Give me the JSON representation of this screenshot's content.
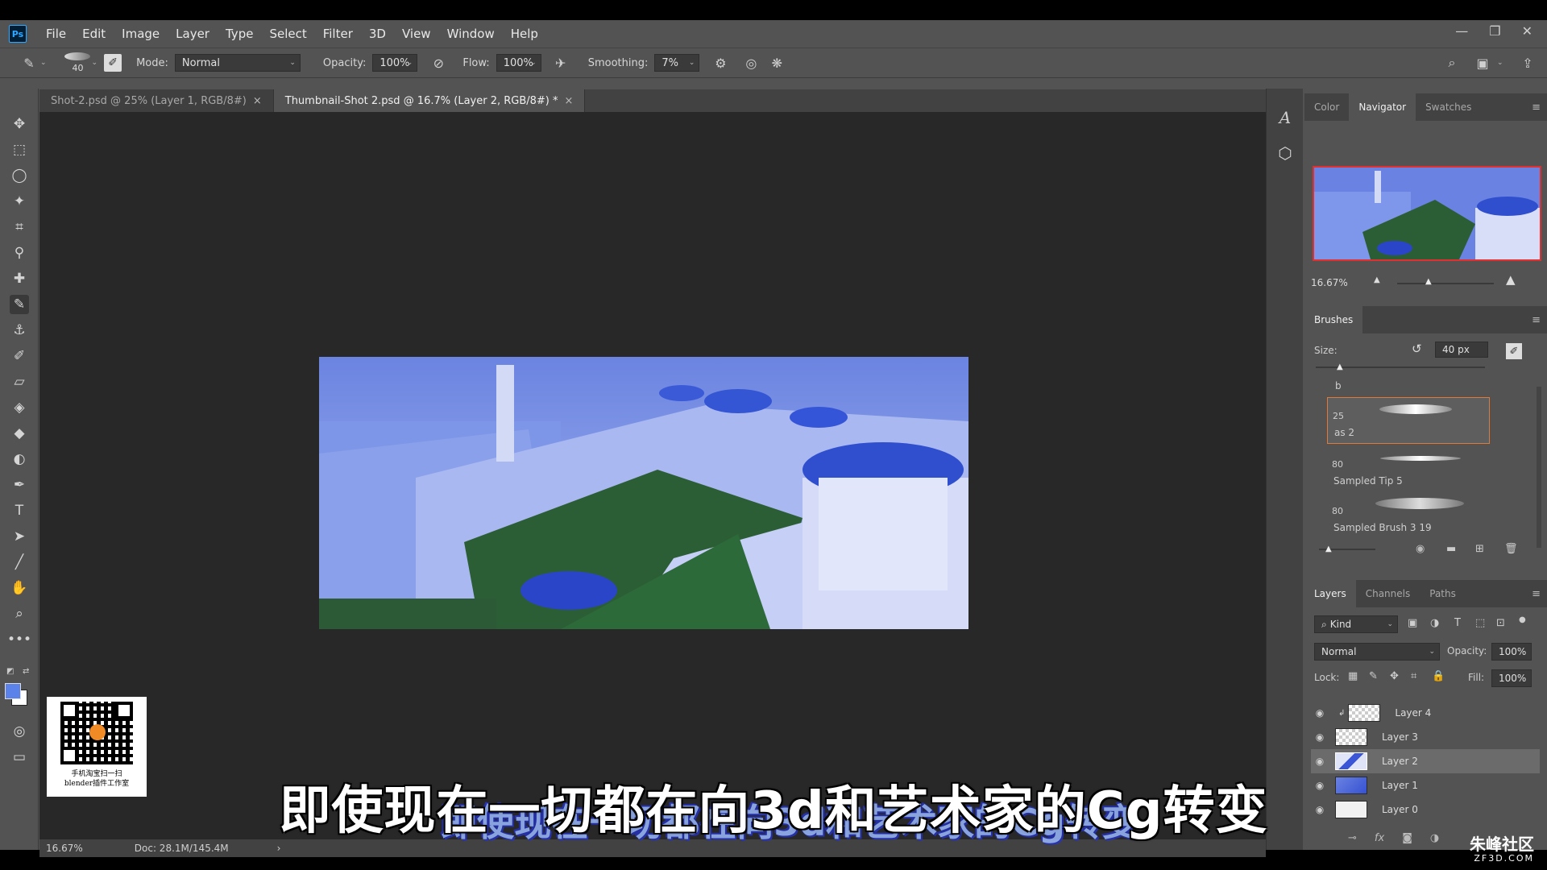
{
  "app": {
    "logo": "Ps"
  },
  "menu": [
    "File",
    "Edit",
    "Image",
    "Layer",
    "Type",
    "Select",
    "Filter",
    "3D",
    "View",
    "Window",
    "Help"
  ],
  "options": {
    "brush_size": "40",
    "mode_label": "Mode:",
    "mode_value": "Normal",
    "opacity_label": "Opacity:",
    "opacity_value": "100%",
    "flow_label": "Flow:",
    "flow_value": "100%",
    "smoothing_label": "Smoothing:",
    "smoothing_value": "7%"
  },
  "tabs": [
    {
      "label": "Shot-2.psd @ 25% (Layer 1, RGB/8#)",
      "close": "×"
    },
    {
      "label": "Thumbnail-Shot 2.psd @ 16.7% (Layer 2, RGB/8#) *",
      "close": "×"
    }
  ],
  "status": {
    "zoom": "16.67%",
    "doc": "Doc: 28.1M/145.4M",
    "arrow": "›"
  },
  "qr": {
    "line1": "手机淘宝扫一扫",
    "line2": "blender插件工作室"
  },
  "navigator": {
    "tabs": [
      "Color",
      "Navigator",
      "Swatches"
    ],
    "zoom": "16.67%"
  },
  "brushes": {
    "title": "Brushes",
    "size_label": "Size:",
    "size_value": "40 px",
    "group_label": "b",
    "items": [
      {
        "num": "25",
        "name": "as 2"
      },
      {
        "num": "80",
        "name": "Sampled Tip 5"
      },
      {
        "num": "80",
        "name": "Sampled Brush 3 19"
      }
    ]
  },
  "layers": {
    "tabs": [
      "Layers",
      "Channels",
      "Paths"
    ],
    "filter": "Kind",
    "blend": "Normal",
    "opacity_label": "Opacity:",
    "opacity_value": "100%",
    "lock_label": "Lock:",
    "fill_label": "Fill:",
    "fill_value": "100%",
    "items": [
      {
        "name": "Layer 4"
      },
      {
        "name": "Layer 3"
      },
      {
        "name": "Layer 2"
      },
      {
        "name": "Layer 1"
      },
      {
        "name": "Layer 0"
      }
    ]
  },
  "subtitle": {
    "main": "即使现在一切都在向3d和艺术家的Cg转变",
    "secondary": "即使现在一切都在向3d和艺术家的Cg转变"
  },
  "watermark": {
    "name": "朱峰社区",
    "url": "ZF3D.COM"
  }
}
